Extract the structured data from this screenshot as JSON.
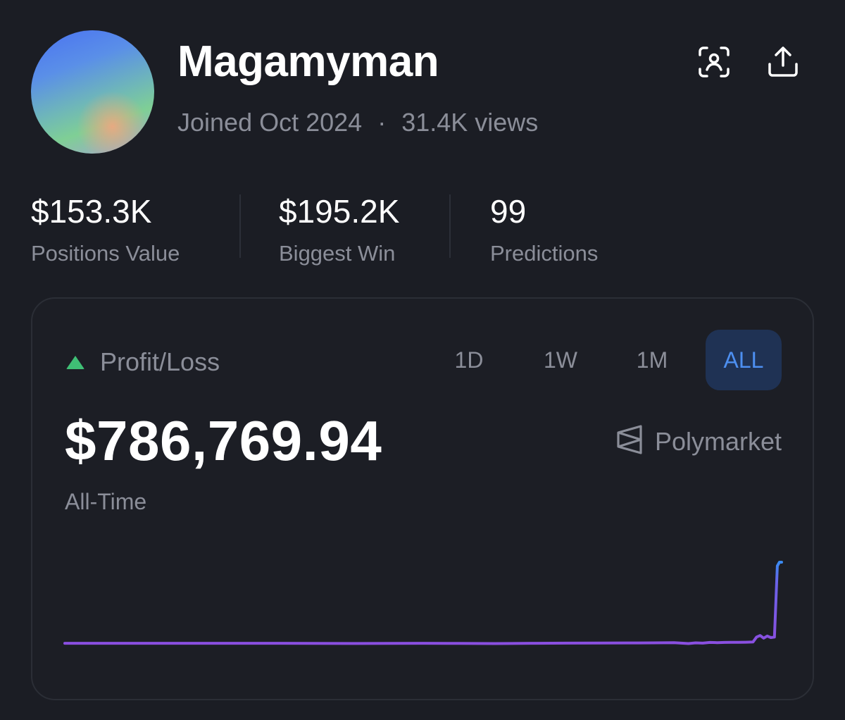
{
  "profile": {
    "name": "Magamyman",
    "joined": "Joined Oct 2024",
    "views": "31.4K views"
  },
  "stats": [
    {
      "value": "$153.3K",
      "label": "Positions Value"
    },
    {
      "value": "$195.2K",
      "label": "Biggest Win"
    },
    {
      "value": "99",
      "label": "Predictions"
    }
  ],
  "pnl": {
    "label": "Profit/Loss",
    "amount": "$786,769.94",
    "range_label": "All-Time",
    "brand": "Polymarket",
    "tabs": [
      "1D",
      "1W",
      "1M",
      "ALL"
    ],
    "active_tab": "ALL",
    "up_color": "#3fbf75"
  },
  "icons": {
    "scan": "face-scan-icon",
    "share": "share-icon",
    "brand": "polymarket-logo-icon",
    "trend": "up-triangle-icon"
  },
  "chart_data": {
    "type": "line",
    "title": "",
    "xlabel": "",
    "ylabel": "",
    "x_units": "index",
    "x": [
      0,
      5,
      10,
      15,
      20,
      25,
      30,
      35,
      40,
      45,
      50,
      55,
      60,
      62,
      65,
      70,
      75,
      80,
      82,
      85,
      87,
      88,
      89,
      90,
      91,
      92,
      93,
      94,
      95,
      96,
      96.5,
      97,
      97.5,
      98,
      98.5,
      99,
      99.4,
      99.7,
      100
    ],
    "values": [
      0,
      0,
      0,
      0,
      0,
      0,
      0,
      -1000,
      -2000,
      -1000,
      -500,
      -1500,
      -3000,
      -2000,
      -500,
      1000,
      2000,
      3000,
      4000,
      5000,
      -3000,
      4000,
      1000,
      8000,
      6000,
      8000,
      9000,
      9000,
      10000,
      12000,
      60000,
      75000,
      50000,
      70000,
      55000,
      60000,
      750000,
      786769.94,
      786769.94
    ],
    "ylim": [
      -20000,
      786769.94
    ],
    "grid": false,
    "colors": {
      "start": "#8a4fe0",
      "end": "#3a8bf2"
    }
  }
}
